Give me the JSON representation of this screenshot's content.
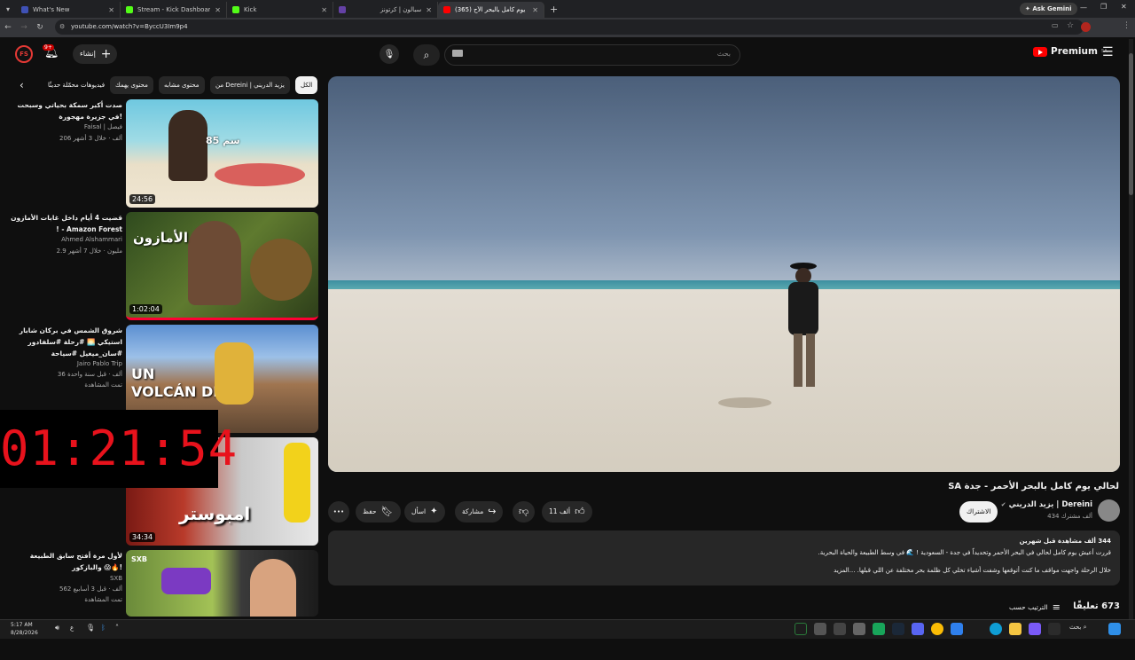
{
  "browser": {
    "tabs": [
      {
        "title": "What's New",
        "color": "#3f51b5"
      },
      {
        "title": "Stream - Kick Dashboard",
        "color": "#53fc18"
      },
      {
        "title": "Kick",
        "color": "#53fc18"
      },
      {
        "title": "سبالون | كرتونز",
        "color": "#6441a5"
      },
      {
        "title": "(365) لحالي يوم كامل بالبحر الأح...",
        "color": "#ff0000"
      }
    ],
    "new_tab": "+",
    "ask_gemini": "Ask Gemini",
    "url": "youtube.com/watch?v=ByccU3Im9p4"
  },
  "header": {
    "create_label": "إنشاء",
    "notif_count": "9+",
    "search_placeholder": "بحث",
    "premium_label": "Premium",
    "country": "SA"
  },
  "chips": [
    "الكل",
    "من Dereini | يزيد الدريني",
    "محتوى مشابه",
    "محتوى يهمك",
    "فيديوهات محمّلة حديثًا"
  ],
  "related": [
    {
      "title": "صدت أكبر سمكة بحياتي وسبحت في جزيرة مهجورة!",
      "channel": "Faisal | فيصل",
      "stats": "206 ألف · خلال 3 أشهر",
      "duration": "24:56",
      "badge": ""
    },
    {
      "title": "قضيت 4 أيام داخل غابات الأمازون ! - Amazon Forest",
      "channel": "Ahmed Alshammari",
      "stats": "2.9 مليون · خلال 7 أشهر",
      "duration": "1:02:04",
      "badge": ""
    },
    {
      "title": "شروق الشمس في بركان شابار استيكي 🌅 #رحلة #سلفادور #سان_ميغيل #سياحة",
      "channel": "Jairo Pablo Trip",
      "stats": "36 ألف · قبل سنة واحدة",
      "duration": "",
      "badge": "تمت المشاهدة"
    },
    {
      "title": "",
      "channel": "",
      "stats": "",
      "duration": "34:34",
      "badge": ""
    },
    {
      "title": "لأول مرة أفتح سابق الطبيعة والبازكور 😱🔥!",
      "channel": "SXB",
      "stats": "562 ألف · قبل 3 أسابيع",
      "duration": "",
      "badge": "تمت المشاهدة"
    }
  ],
  "thumb_text": {
    "fish_cm": "85 سم",
    "amazon": "الأمازون",
    "volcan_1": "UN",
    "volcan_2": "VOLCÁN DE",
    "amboster": "امبوستر",
    "sxb": "SXB"
  },
  "timer": "01:21:54",
  "video": {
    "title": "لحالي يوم كامل بالبحر الأحمر - جدة SA",
    "channel": "Dereini | يزيد الدريني",
    "subscribers": "434 ألف مشترك",
    "subscribe_label": "الاشتراك",
    "likes": "11 ألف",
    "share_label": "مشاركة",
    "ask_label": "اسأل",
    "save_label": "حفظ",
    "more_label": "•••"
  },
  "description": {
    "meta": "344 ألف مشاهدة  قبل شهرين",
    "line1": "قررت أعيش يوم كامل لحالي في البحر الأحمر وتحديداً في جدة - السعودية ! 🌊 في وسط الطبيعة والحياة البحرية.",
    "line2": "خلال الرحلة واجهت مواقف ما كنت أتوقعها وشفت أشياء تخلي كل ظلمة بحر مختلفة عن اللي قبلها. ...المزيد"
  },
  "comments": {
    "count": "673 تعليقًا",
    "sort_label": "الترتيب حسب"
  },
  "taskbar": {
    "time": "5:17 AM",
    "date": "8/28/2026",
    "search": "بحث"
  },
  "colors": {
    "bg": "#0f0f0f",
    "chip": "#272727",
    "accent_red": "#ff0000",
    "timer_red": "#e8121c"
  }
}
